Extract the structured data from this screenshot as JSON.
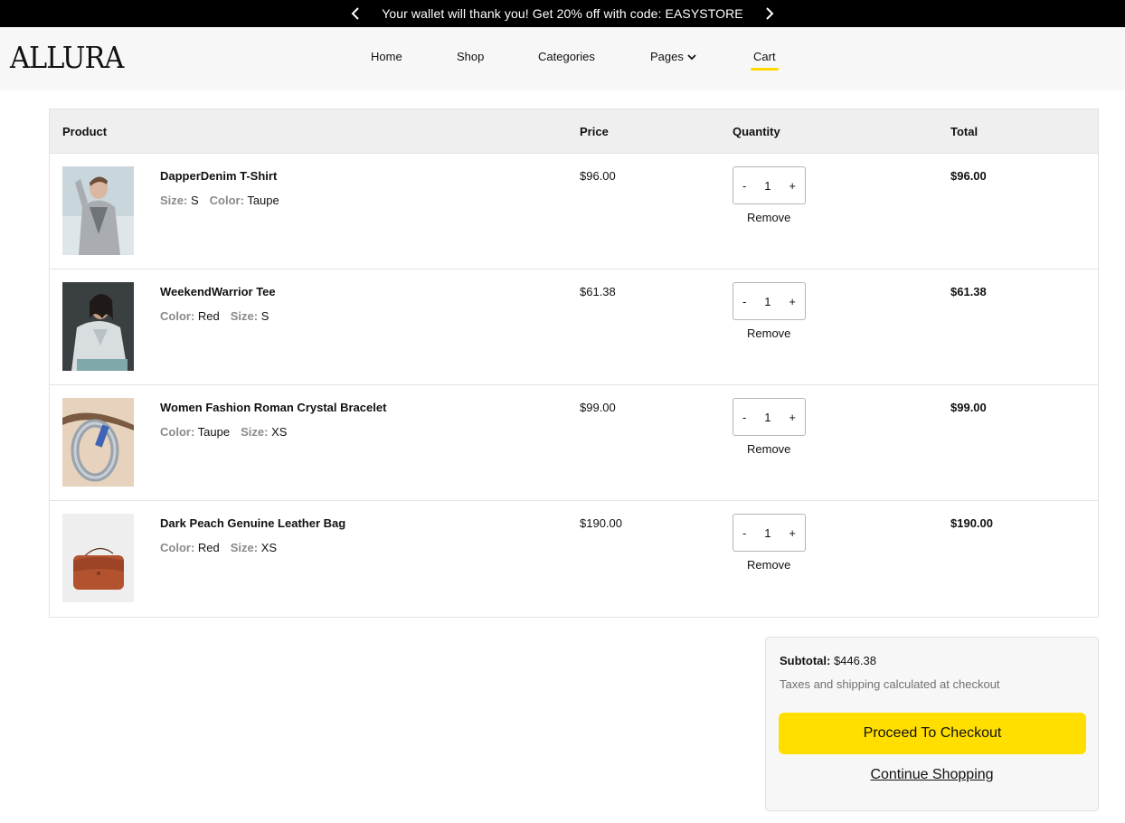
{
  "announcement": {
    "text": "Your wallet will thank you! Get 20% off with code: EASYSTORE"
  },
  "header": {
    "logo": "ALLURA",
    "nav": [
      {
        "label": "Home"
      },
      {
        "label": "Shop"
      },
      {
        "label": "Categories"
      },
      {
        "label": "Pages"
      },
      {
        "label": "Cart"
      }
    ],
    "active_nav": "Cart",
    "accent_color": "#ffd800"
  },
  "cart": {
    "columns": [
      "Product",
      "Price",
      "Quantity",
      "Total"
    ],
    "remove_label": "Remove",
    "minus_label": "-",
    "plus_label": "+",
    "items": [
      {
        "name": "DapperDenim T-Shirt",
        "attr1_key": "Size:",
        "attr1_val": "S",
        "attr2_key": "Color:",
        "attr2_val": "Taupe",
        "price": "$96.00",
        "qty": "1",
        "total": "$96.00"
      },
      {
        "name": "WeekendWarrior Tee",
        "attr1_key": "Color:",
        "attr1_val": "Red",
        "attr2_key": "Size:",
        "attr2_val": "S",
        "price": "$61.38",
        "qty": "1",
        "total": "$61.38"
      },
      {
        "name": "Women Fashion Roman Crystal Bracelet",
        "attr1_key": "Color:",
        "attr1_val": "Taupe",
        "attr2_key": "Size:",
        "attr2_val": "XS",
        "price": "$99.00",
        "qty": "1",
        "total": "$99.00"
      },
      {
        "name": "Dark Peach Genuine Leather Bag",
        "attr1_key": "Color:",
        "attr1_val": "Red",
        "attr2_key": "Size:",
        "attr2_val": "XS",
        "price": "$190.00",
        "qty": "1",
        "total": "$190.00"
      }
    ]
  },
  "summary": {
    "subtotal_label": "Subtotal:",
    "subtotal_value": "$446.38",
    "tax_note": "Taxes and shipping calculated at checkout",
    "checkout_label": "Proceed To Checkout",
    "continue_label": "Continue Shopping",
    "checkout_color": "#ffde00"
  }
}
